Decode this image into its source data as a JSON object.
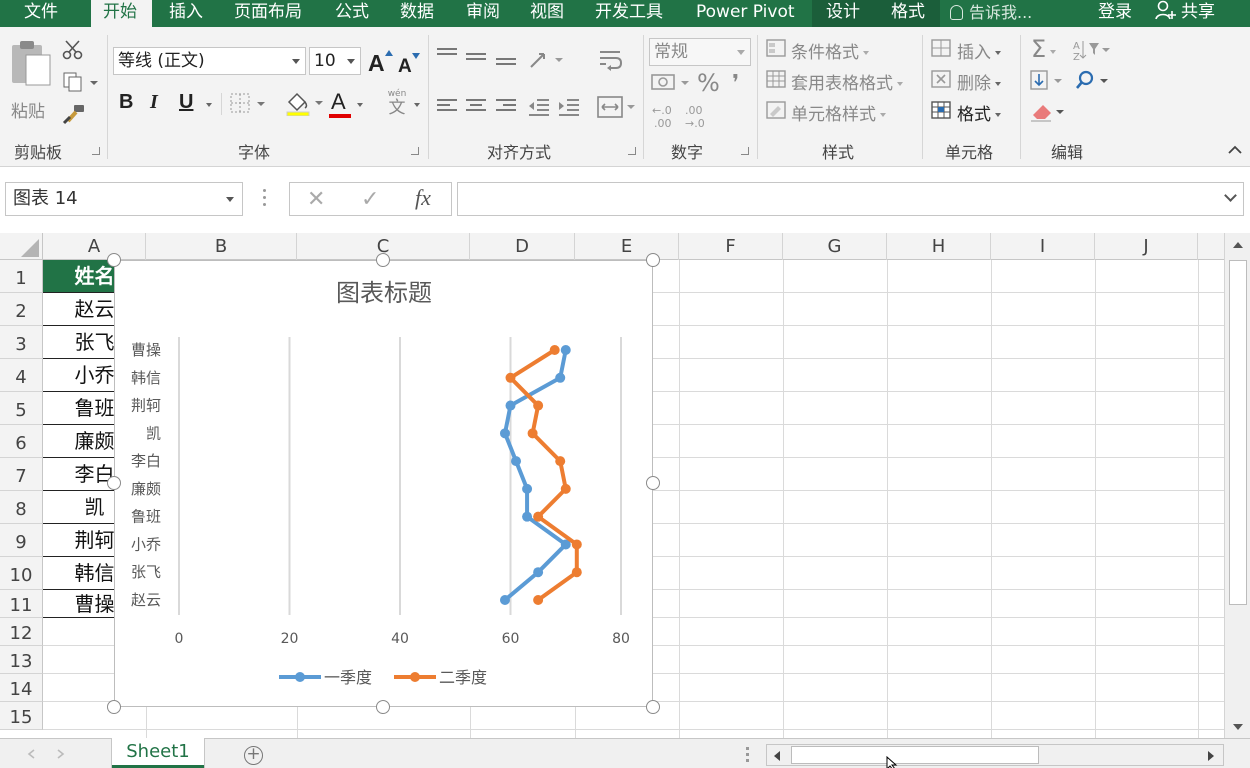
{
  "tabs": {
    "file": "文件",
    "home": "开始",
    "insert": "插入",
    "page_layout": "页面布局",
    "formulas": "公式",
    "data": "数据",
    "review": "审阅",
    "view": "视图",
    "developer": "开发工具",
    "power_pivot": "Power Pivot",
    "design": "设计",
    "format": "格式"
  },
  "tell_me": "告诉我...",
  "login": "登录",
  "share": "共享",
  "ribbon": {
    "clipboard": {
      "paste": "粘贴",
      "label": "剪贴板"
    },
    "font": {
      "name": "等线 (正文)",
      "size": "10",
      "bold": "B",
      "italic": "I",
      "underline": "U",
      "increase": "A",
      "decrease": "A",
      "color": "A",
      "phonetic": "文",
      "phonetic_top": "wén",
      "label": "字体"
    },
    "alignment": {
      "label": "对齐方式"
    },
    "number": {
      "format": "常规",
      "percent": "%",
      "comma": "❜",
      "label": "数字"
    },
    "styles": {
      "conditional": "条件格式",
      "table": "套用表格格式",
      "cell": "单元格样式",
      "label": "样式"
    },
    "cells": {
      "insert": "插入",
      "delete": "删除",
      "format": "格式",
      "label": "单元格"
    },
    "editing": {
      "sum": "Σ",
      "label": "编辑"
    }
  },
  "formula_bar": {
    "name_box": "图表 14",
    "cancel": "✕",
    "enter": "✓",
    "fx": "fx",
    "value": ""
  },
  "columns": [
    "A",
    "B",
    "C",
    "D",
    "E",
    "F",
    "G",
    "H",
    "I",
    "J"
  ],
  "rows": [
    "1",
    "2",
    "3",
    "4",
    "5",
    "6",
    "7",
    "8",
    "9",
    "10",
    "11",
    "12",
    "13",
    "14",
    "15"
  ],
  "column_a": [
    "姓名",
    "赵云",
    "张飞",
    "小乔",
    "鲁班",
    "廉颇",
    "李白",
    "凯",
    "荆轲",
    "韩信",
    "曹操"
  ],
  "chart_data": {
    "type": "line",
    "title": "图表标题",
    "categories": [
      "赵云",
      "张飞",
      "小乔",
      "鲁班",
      "廉颇",
      "李白",
      "凯",
      "荆轲",
      "韩信",
      "曹操"
    ],
    "series": [
      {
        "name": "一季度",
        "color": "#5b9bd5",
        "values": [
          59,
          65,
          70,
          63,
          63,
          61,
          59,
          60,
          69,
          70
        ]
      },
      {
        "name": "二季度",
        "color": "#ed7d31",
        "values": [
          65,
          72,
          72,
          65,
          70,
          69,
          64,
          65,
          60,
          68
        ]
      }
    ],
    "value_axis": {
      "min": 0,
      "max": 80,
      "ticks": [
        "0",
        "20",
        "40",
        "60",
        "80"
      ]
    },
    "orientation": "values horizontal, categories vertical (bottom to top)",
    "grid": true,
    "legend": "bottom"
  },
  "sheet_tab": "Sheet1",
  "add_sheet": "+",
  "colors": {
    "excel_green": "#217346"
  }
}
